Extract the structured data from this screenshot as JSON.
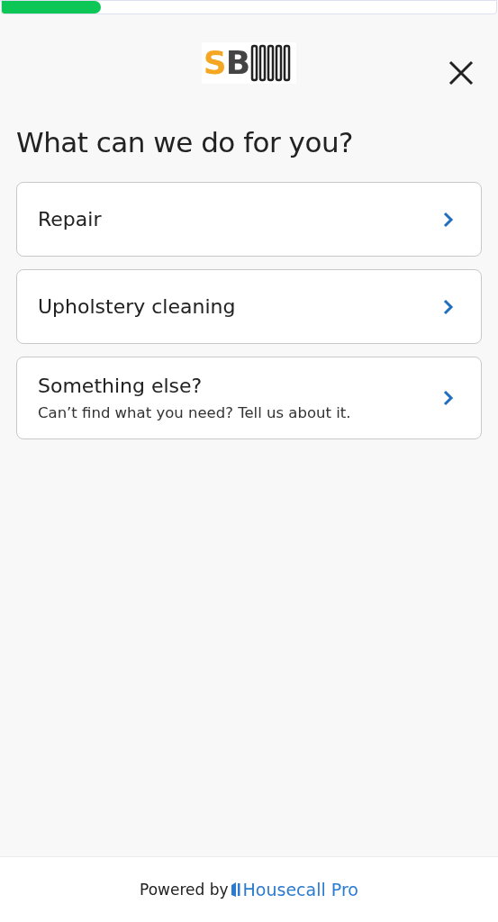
{
  "progress": {
    "level": 0.2
  },
  "header": {
    "logo": {
      "letters": [
        "S",
        "B"
      ]
    }
  },
  "title": "What can we do for you?",
  "options": [
    {
      "label": "Repair"
    },
    {
      "label": "Upholstery cleaning"
    },
    {
      "label": "Something else?",
      "description": "Can’t find what you need? Tell us about it."
    }
  ],
  "footer": {
    "prefix": "Powered by",
    "brand": "Housecall Pro"
  }
}
